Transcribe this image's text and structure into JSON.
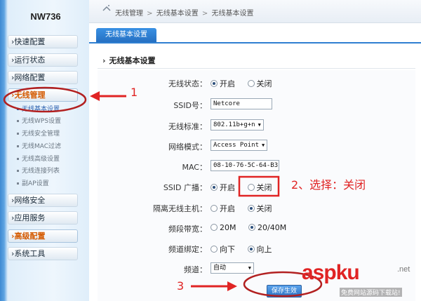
{
  "sidebar": {
    "model": "NW736",
    "menu": [
      {
        "label": "›快速配置"
      },
      {
        "label": "›运行状态"
      },
      {
        "label": "›网络配置"
      },
      {
        "label": "›无线管理"
      }
    ],
    "sub_items": [
      {
        "label": "无线基本设置"
      },
      {
        "label": "无线WPS设置"
      },
      {
        "label": "无线安全管理"
      },
      {
        "label": "无线MAC过滤"
      },
      {
        "label": "无线高级设置"
      },
      {
        "label": "无线连接列表"
      },
      {
        "label": "副AP设置"
      }
    ],
    "menu_bottom": [
      {
        "label": "›网络安全"
      },
      {
        "label": "›应用服务"
      },
      {
        "label": "›高级配置"
      },
      {
        "label": "›系统工具"
      }
    ]
  },
  "breadcrumb": {
    "items": [
      "无线管理",
      "无线基本设置",
      "无线基本设置"
    ],
    "sep": " > "
  },
  "tab": {
    "label": "无线基本设置"
  },
  "section": {
    "title": "无线基本设置"
  },
  "form": {
    "wireless_status": {
      "label": "无线状态：",
      "options": [
        "开启",
        "关闭"
      ],
      "selected": "开启"
    },
    "ssid": {
      "label": "SSID号：",
      "value": "Netcore"
    },
    "standard": {
      "label": "无线标准：",
      "value": "802.11b+g+n"
    },
    "mode": {
      "label": "网络模式：",
      "value": "Access Point"
    },
    "mac": {
      "label": "MAC：",
      "value": "08-10-76-5C-64-B3"
    },
    "ssid_broadcast": {
      "label": "SSID 广播：",
      "options": [
        "开启",
        "关闭"
      ],
      "selected": "开启"
    },
    "isolate": {
      "label": "隔离无线主机：",
      "options": [
        "开启",
        "关闭"
      ],
      "selected": "关闭"
    },
    "bandwidth": {
      "label": "频段带宽：",
      "options": [
        "20M",
        "20/40M"
      ],
      "selected": "20/40M"
    },
    "channel_bind": {
      "label": "频道绑定：",
      "options": [
        "向下",
        "向上"
      ],
      "selected": "向上"
    },
    "channel": {
      "label": "频道：",
      "value": "自动"
    },
    "save_label": "保存生效"
  },
  "annotations": {
    "a1": "1",
    "a2": "2、选择：关闭",
    "a3": "3"
  },
  "watermark": {
    "logo": "aspku",
    "tld": ".net",
    "sub": "免费网站源码下载站!"
  },
  "colors": {
    "annotation": "#e02424",
    "accent": "#2f7fd1",
    "active_menu": "#d55a00"
  }
}
